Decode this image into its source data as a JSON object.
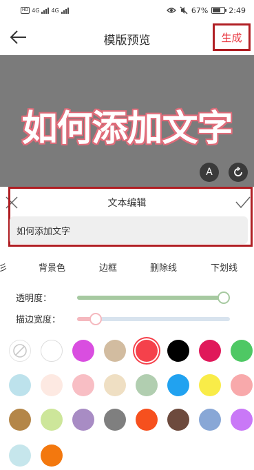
{
  "status_bar": {
    "network": "HD",
    "signal_a": "4G",
    "signal_b": "4G",
    "battery_percent": "67%",
    "battery_level": 0.67,
    "time": "2:49"
  },
  "header": {
    "title": "模版预览",
    "generate_label": "生成"
  },
  "preview": {
    "text": "如何添加文字",
    "font_button_label": "A"
  },
  "editor": {
    "title": "文本编辑",
    "input_value": "如何添加文字"
  },
  "tabs": [
    "彡",
    "背景色",
    "边框",
    "删除线",
    "下划线"
  ],
  "sliders": {
    "opacity": {
      "label": "透明度：",
      "value": 1.0,
      "color": "#a6c9a0"
    },
    "stroke_width": {
      "label": "描边宽度：",
      "value": 0.09,
      "color": "#f5b8be"
    }
  },
  "colors": [
    "none",
    "#ffffff",
    "#d94ee0",
    "#d2bca0",
    "#f5414b",
    "#000000",
    "#e0195a",
    "#4ec864",
    "#bde2ec",
    "#fde9e2",
    "#f8bec4",
    "#efdfc3",
    "#b1ceb0",
    "#21a2f0",
    "#f9ec48",
    "#f8a9ab",
    "#b48648",
    "#cde69a",
    "#a88cc4",
    "#7f7f7f",
    "#f6501e",
    "#6d4a3d",
    "#88a7d6",
    "#c978f7",
    "#c6e6ec",
    "#f3780e"
  ],
  "selected_color_index": 4
}
